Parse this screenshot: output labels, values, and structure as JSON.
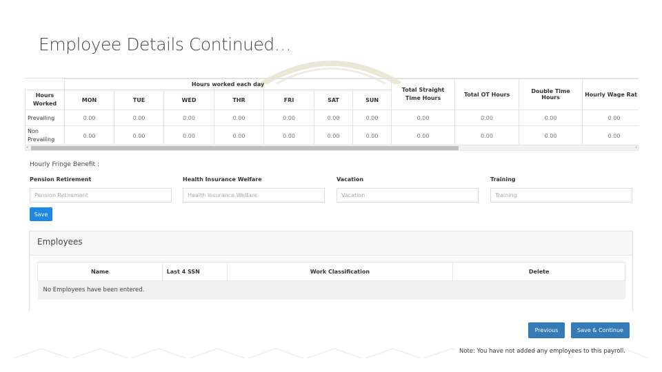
{
  "page": {
    "title": "Employee Details Continued…"
  },
  "hours_table": {
    "group_header": "Hours worked each day",
    "corner_label": "Hours Worked",
    "days": [
      "MON",
      "TUE",
      "WED",
      "THR",
      "FRI",
      "SAT",
      "SUN"
    ],
    "extra_headers": [
      "Total Straight Time Hours",
      "Total OT Hours",
      "Double Time Hours",
      "Hourly Wage Rat"
    ],
    "rows": [
      {
        "label": "Prevailing",
        "values": [
          "0.00",
          "0.00",
          "0.00",
          "0.00",
          "0.00",
          "0.00",
          "0.00",
          "0.00",
          "0.00",
          "0.00",
          "0.00"
        ]
      },
      {
        "label": "Non Prevailing",
        "values": [
          "0.00",
          "0.00",
          "0.00",
          "0.00",
          "0.00",
          "0.00",
          "0.00",
          "0.00",
          "0.00",
          "0.00",
          "0.00"
        ]
      }
    ]
  },
  "fringe": {
    "title": "Hourly Fringe Benefit :",
    "fields": [
      {
        "label": "Pension Retirement",
        "placeholder": "Pension Retirement"
      },
      {
        "label": "Health Insurance Welfare",
        "placeholder": "Health Insurance Welfare"
      },
      {
        "label": "Vacation",
        "placeholder": "Vacation"
      },
      {
        "label": "Training",
        "placeholder": "Training"
      }
    ],
    "save_label": "Save"
  },
  "employees": {
    "heading": "Employees",
    "columns": [
      "Name",
      "Last 4 SSN",
      "Work Classification",
      "Delete"
    ],
    "empty_message": "No Employees have been entered."
  },
  "nav": {
    "previous_label": "Previous",
    "continue_label": "Save & Continue"
  },
  "note": "Note: You have not added any employees to this payroll.",
  "colors": {
    "primary": "#337ab7",
    "save": "#1e88e5"
  }
}
